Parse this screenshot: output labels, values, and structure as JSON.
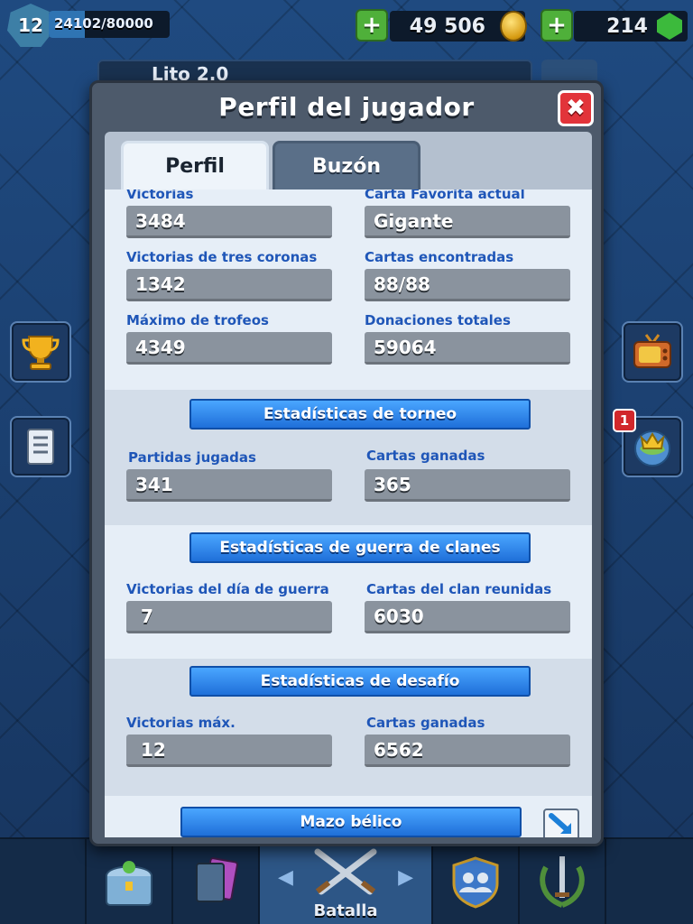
{
  "hud": {
    "level": "12",
    "xp_text": "24102/80000",
    "xp_progress": 0.3,
    "gold": "49 506",
    "gems": "214",
    "player_name": "Lito 2.0"
  },
  "modal": {
    "title": "Perfil del jugador",
    "close_label": "✖",
    "tabs": [
      {
        "label": "Perfil",
        "active": true
      },
      {
        "label": "Buzón",
        "active": false
      }
    ],
    "general": {
      "wins_label": "Victorias",
      "wins": "3484",
      "fav_card_label": "Carta Favorita actual",
      "fav_card": "Gigante",
      "three_crown_label": "Victorias de tres coronas",
      "three_crown": "1342",
      "cards_found_label": "Cartas encontradas",
      "cards_found": "88/88",
      "max_trophies_label": "Máximo de trofeos",
      "max_trophies": "4349",
      "donations_label": "Donaciones totales",
      "donations": "59064"
    },
    "tournament": {
      "title": "Estadísticas de torneo",
      "played_label": "Partidas jugadas",
      "played": "341",
      "cards_won_label": "Cartas ganadas",
      "cards_won": "365"
    },
    "clan_war": {
      "title": "Estadísticas de guerra de clanes",
      "war_day_wins_label": "Victorias del día de guerra",
      "war_day_wins": "7",
      "clan_cards_label": "Cartas del clan reunidas",
      "clan_cards": "6030"
    },
    "challenge": {
      "title": "Estadísticas de desafío",
      "max_wins_label": "Victorias máx.",
      "max_wins": "12",
      "cards_won_label": "Cartas ganadas",
      "cards_won": "6562"
    },
    "war_deck": {
      "title": "Mazo bélico"
    }
  },
  "side": {
    "notification_count": "1"
  },
  "nav": {
    "battle_label": "Batalla"
  },
  "colors": {
    "label_blue": "#1f56b8",
    "ribbon_blue": "#2a86f0",
    "value_box": "#8a939e",
    "close_red": "#e2343a",
    "plus_green": "#4fb03a"
  }
}
